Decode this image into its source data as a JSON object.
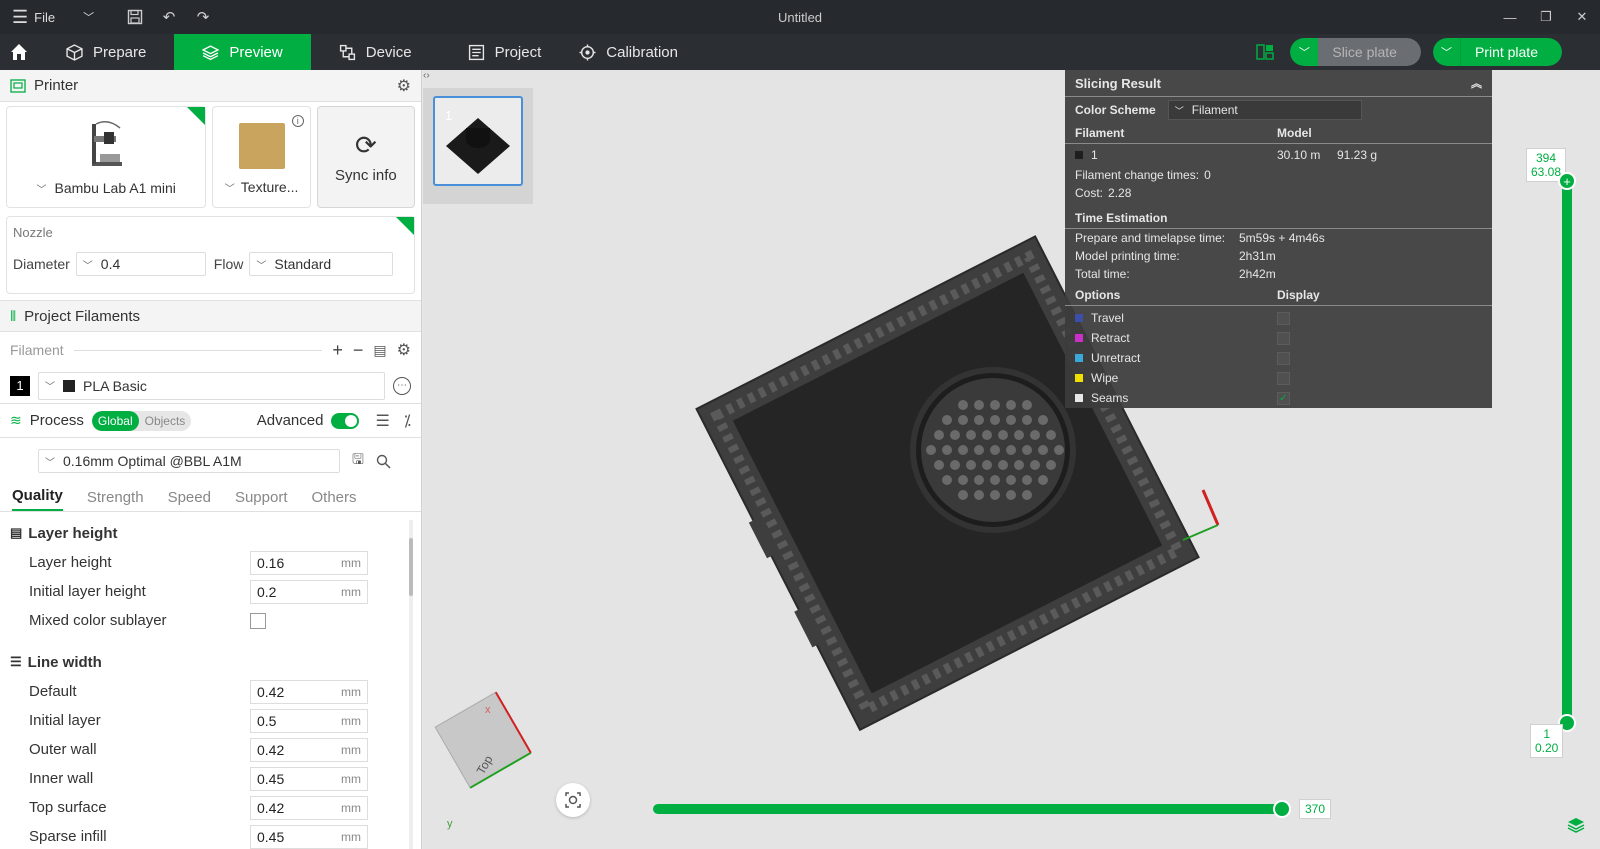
{
  "titlebar": {
    "file_label": "File",
    "title": "Untitled"
  },
  "tabs": [
    {
      "label": "Prepare",
      "icon": "cube-icon"
    },
    {
      "label": "Preview",
      "icon": "layers-icon",
      "active": true
    },
    {
      "label": "Device",
      "icon": "device-icon"
    },
    {
      "label": "Project",
      "icon": "project-icon"
    },
    {
      "label": "Calibration",
      "icon": "calibration-icon"
    }
  ],
  "actions": {
    "slice_label": "Slice plate",
    "print_label": "Print plate"
  },
  "colors": {
    "accent": "#00ae42",
    "titlebar_bg": "#262a2e",
    "tabbar_bg": "#2b2f33"
  },
  "printer": {
    "section_title": "Printer",
    "printer_name": "Bambu Lab A1 mini",
    "plate_name": "Texture...",
    "sync_label": "Sync info",
    "nozzle_title": "Nozzle",
    "diameter_label": "Diameter",
    "diameter_value": "0.4",
    "flow_label": "Flow",
    "flow_value": "Standard"
  },
  "filaments": {
    "section_title": "Project Filaments",
    "filament_label": "Filament",
    "items": [
      {
        "index": "1",
        "name": "PLA Basic"
      }
    ]
  },
  "process": {
    "section_title": "Process",
    "global_label": "Global",
    "objects_label": "Objects",
    "advanced_label": "Advanced",
    "advanced_on": true,
    "preset": "0.16mm Optimal @BBL A1M",
    "subtabs": [
      "Quality",
      "Strength",
      "Speed",
      "Support",
      "Others"
    ],
    "active_subtab": "Quality",
    "groups": [
      {
        "title": "Layer height",
        "rows": [
          {
            "label": "Layer height",
            "value": "0.16",
            "unit": "mm"
          },
          {
            "label": "Initial layer height",
            "value": "0.2",
            "unit": "mm"
          },
          {
            "label": "Mixed color sublayer",
            "checkbox": false
          }
        ]
      },
      {
        "title": "Line width",
        "rows": [
          {
            "label": "Default",
            "value": "0.42",
            "unit": "mm"
          },
          {
            "label": "Initial layer",
            "value": "0.5",
            "unit": "mm"
          },
          {
            "label": "Outer wall",
            "value": "0.42",
            "unit": "mm"
          },
          {
            "label": "Inner wall",
            "value": "0.45",
            "unit": "mm"
          },
          {
            "label": "Top surface",
            "value": "0.42",
            "unit": "mm"
          },
          {
            "label": "Sparse infill",
            "value": "0.45",
            "unit": "mm"
          }
        ]
      }
    ]
  },
  "plate_thumb": {
    "number": "1"
  },
  "slicing_result": {
    "title": "Slicing Result",
    "color_scheme_label": "Color Scheme",
    "color_scheme_value": "Filament",
    "col_filament": "Filament",
    "col_model": "Model",
    "filament_index": "1",
    "filament_length": "30.10 m",
    "filament_weight": "91.23 g",
    "change_times_label": "Filament change times:",
    "change_times_value": "0",
    "cost_label": "Cost:",
    "cost_value": "2.28",
    "time_title": "Time Estimation",
    "prepare_label": "Prepare and timelapse time:",
    "prepare_value": "5m59s + 4m46s",
    "model_time_label": "Model printing time:",
    "model_time_value": "2h31m",
    "total_label": "Total time:",
    "total_value": "2h42m",
    "options_label": "Options",
    "display_label": "Display",
    "options": [
      {
        "label": "Travel",
        "color": "#3b4fa8",
        "checked": false
      },
      {
        "label": "Retract",
        "color": "#c830c8",
        "checked": false
      },
      {
        "label": "Unretract",
        "color": "#3aa8d8",
        "checked": false
      },
      {
        "label": "Wipe",
        "color": "#f0e000",
        "checked": false
      },
      {
        "label": "Seams",
        "color": "#e8e8e8",
        "checked": true
      }
    ]
  },
  "layer_slider": {
    "top_layer": "394",
    "top_height": "63.08",
    "bottom_layer": "1",
    "bottom_height": "0.20"
  },
  "move_slider": {
    "value": "370"
  },
  "axes": {
    "x": "x",
    "y": "y",
    "cube_face": "Top"
  }
}
